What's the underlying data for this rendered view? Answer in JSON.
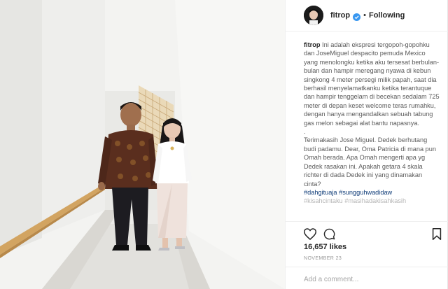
{
  "post": {
    "photo": {
      "description_icon": "couple-photo",
      "colors": {
        "wall": "#f3f3f1",
        "shadow_wall": "#dededb",
        "floor": "#ecebe8",
        "rail": "#d2a461",
        "batik_shirt": "#5a2e1e",
        "blouse": "#ffffff",
        "skirt": "#efe2dc"
      }
    },
    "header": {
      "username": "fitrop",
      "verified_icon": "verified-badge-icon",
      "separator": "•",
      "follow_state": "Following"
    },
    "caption": {
      "username": "fitrop",
      "paragraph1": "Ini adalah ekspresi tergopoh-gopohku dan JoseMiguel despacito pemuda Mexico yang menolongku ketika aku tersesat berbulan-bulan dan hampir meregang nyawa di kebun singkong 4 meter persegi milik papah, saat dia berhasil menyelamatkanku ketika terantuque dan hampir tenggelam di becekan sedalam 725 meter di depan keset welcome teras rumahku, dengan hanya mengandalkan sebuah tabung gas melon sebagai alat bantu napasnya.",
      "dot_line": ".",
      "paragraph2": "Terimakasih Jose Miguel. Dedek berhutang budi padamu. Dear, Oma Patricia di mana pun Omah berada. Apa Omah mengerti apa yg Dedek rasakan ini. Apakah getara 4 skala richter di dada Dedek ini yang dinamakan cinta?",
      "hashtag1": "#dahgituaja",
      "hashtag_sep": " ",
      "hashtag2": "#sungguhwadidaw",
      "faded_line": "#kisahcintaku #masihadakisahkasih"
    },
    "actions": {
      "like_icon": "heart-icon",
      "comment_icon": "comment-icon",
      "save_icon": "bookmark-icon",
      "likes": "16,657 likes",
      "date": "NOVEMBER 23",
      "comment_placeholder": "Add a comment..."
    }
  }
}
